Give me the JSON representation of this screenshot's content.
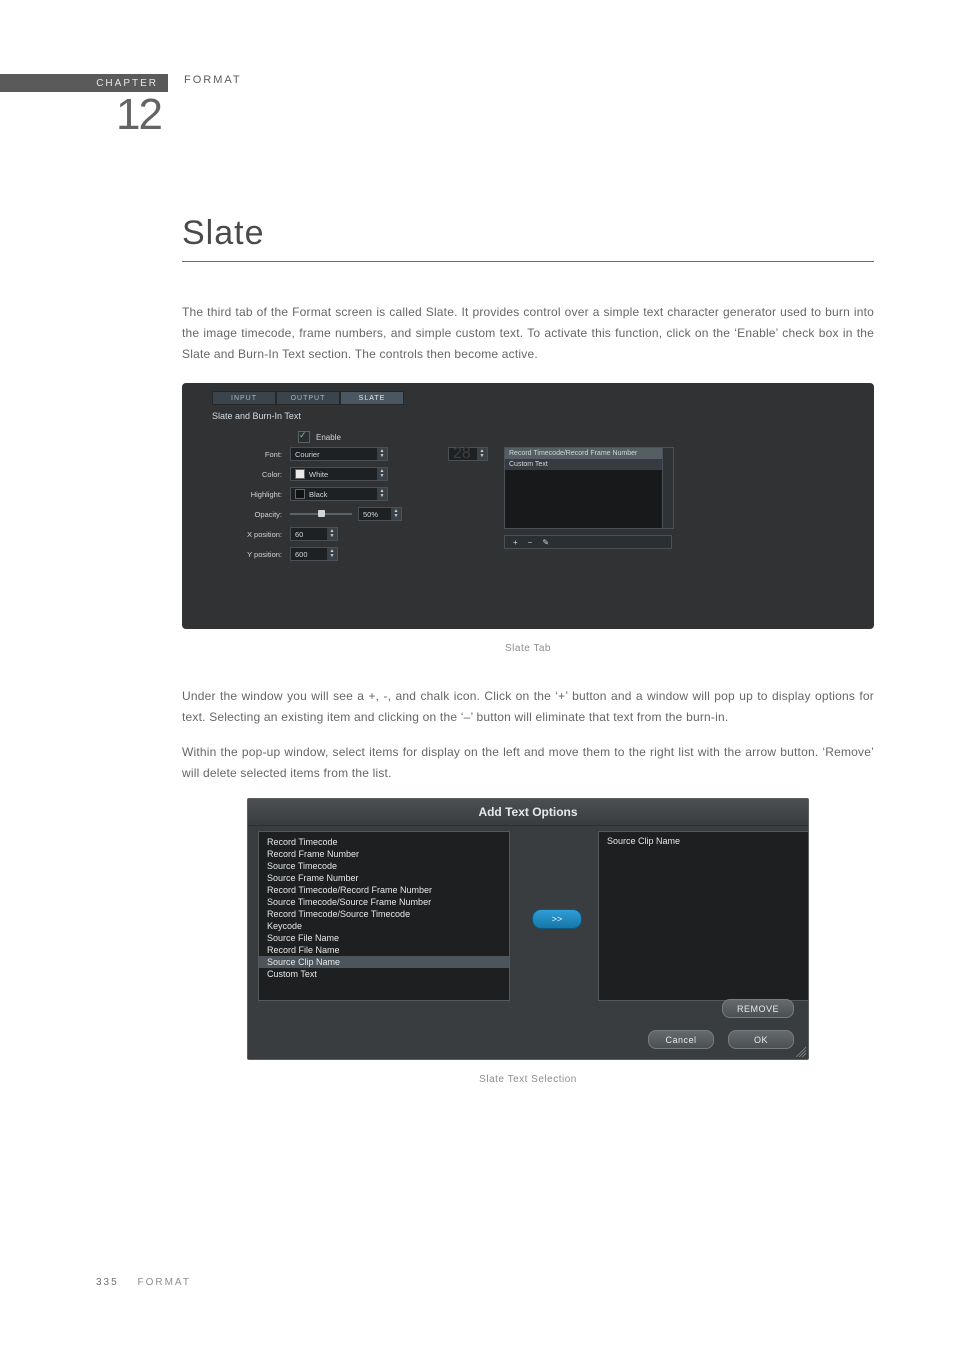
{
  "header": {
    "chapter_label": "CHAPTER",
    "chapter_number": "12",
    "section": "FORMAT"
  },
  "title": "Slate",
  "paragraphs": {
    "p1": "The third tab of the Format screen is called Slate. It provides control over a simple text character generator used to burn into the image timecode, frame numbers, and simple custom text. To activate this function, click on the ‘Enable’ check box in the Slate and Burn-In Text section. The controls then become active.",
    "p2": "Under the window you will see a +, -, and chalk icon. Click on the ‘+’ button and a window will pop up to display options for text. Selecting an existing item and clicking on the ‘–’ button will eliminate that text from the burn-in.",
    "p3": "Within the pop-up window, select items for display on the left and move them to the right list with the arrow button. ‘Remove’ will delete selected items from the list."
  },
  "captions": {
    "c1": "Slate Tab",
    "c2": "Slate Text Selection"
  },
  "shot1": {
    "tabs": {
      "input": "INPUT",
      "output": "OUTPUT",
      "slate": "SLATE"
    },
    "panel_title": "Slate and Burn-In Text",
    "enable": "Enable",
    "labels": {
      "font": "Font:",
      "color": "Color:",
      "highlight": "Highlight:",
      "opacity": "Opacity:",
      "xpos": "X position:",
      "ypos": "Y position:"
    },
    "values": {
      "font": "Courier",
      "font_size": "28",
      "color": "White",
      "highlight": "Black",
      "opacity": "50%",
      "xpos": "60",
      "ypos": "600"
    },
    "list": {
      "row1": "Record Timecode/Record Frame Number",
      "row2": "Custom Text"
    },
    "buttons": {
      "add": "+",
      "remove": "−",
      "edit": "✎"
    }
  },
  "shot2": {
    "title": "Add Text Options",
    "left_items": [
      "Record Timecode",
      "Record Frame Number",
      "Source Timecode",
      "Source Frame Number",
      "Record Timecode/Record Frame Number",
      "Source Timecode/Source Frame Number",
      "Record Timecode/Source Timecode",
      "Keycode",
      "Source File Name",
      "Record File Name",
      "Source Clip Name",
      "Custom Text"
    ],
    "selected_left_index": 10,
    "right_items": [
      "Source Clip Name"
    ],
    "transfer": ">>",
    "remove": "REMOVE",
    "cancel": "Cancel",
    "ok": "OK"
  },
  "footer": {
    "page": "335",
    "section": "FORMAT"
  }
}
